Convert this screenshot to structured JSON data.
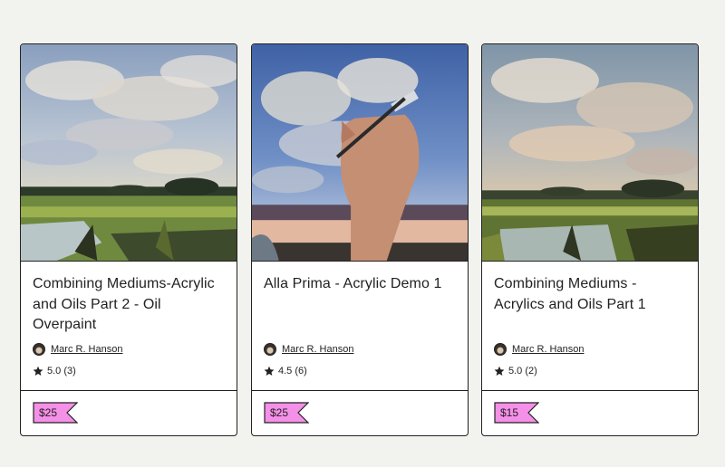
{
  "cards": [
    {
      "title": "Combining Mediums-Acrylic and Oils Part 2 - Oil Overpaint",
      "author": "Marc R. Hanson",
      "rating": "5.0 (3)",
      "price": "$25"
    },
    {
      "title": "Alla Prima - Acrylic Demo 1",
      "author": "Marc R. Hanson",
      "rating": "4.5 (6)",
      "price": "$25"
    },
    {
      "title": "Combining Mediums - Acrylics and Oils Part 1",
      "author": "Marc R. Hanson",
      "rating": "5.0 (2)",
      "price": "$15"
    }
  ],
  "icons": {
    "star": "star-icon",
    "price_tag": "price-tag-icon"
  },
  "colors": {
    "price_tag_fill": "#f590e8",
    "border": "#222222",
    "background": "#f2f2ef"
  }
}
